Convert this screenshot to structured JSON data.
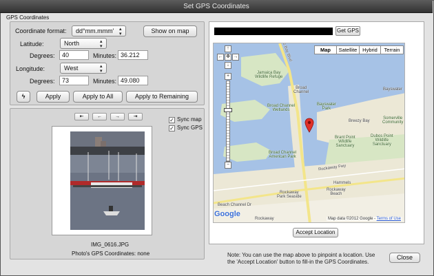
{
  "window": {
    "title": "Set GPS Coordinates"
  },
  "coords": {
    "section_label": "GPS Coordinates",
    "format_label": "Coordinate format:",
    "format_value": "dd°mm.mmm'",
    "show_on_map": "Show on map",
    "latitude_label": "Latitude:",
    "latitude_value": "North",
    "lat_degrees_label": "Degrees:",
    "lat_degrees": "40",
    "lat_minutes_label": "Minutes:",
    "lat_minutes": "36.212",
    "longitude_label": "Longitude:",
    "longitude_value": "West",
    "lon_degrees_label": "Degrees:",
    "lon_degrees": "73",
    "lon_minutes_label": "Minutes:",
    "lon_minutes": "49.080",
    "apply": "Apply",
    "apply_all": "Apply to All",
    "apply_remaining": "Apply to Remaining"
  },
  "photo": {
    "nav": [
      "⇤",
      "←",
      "→",
      "⇥"
    ],
    "sync_map": "Sync map",
    "sync_gps": "Sync GPS",
    "filename": "IMG_0616.JPG",
    "gps_status": "Photo's GPS Coordinates: none"
  },
  "map": {
    "get_gps": "Get GPS",
    "tabs": [
      "Map",
      "Satellite",
      "Hybrid",
      "Terrain"
    ],
    "active_tab": "Map",
    "labels": {
      "jamaica_bay": "Jamaica Bay\nWildlife Refuge",
      "broad_channel": "Broad\nChannel",
      "broad_channel_wetlands": "Broad Channel\nWetlands",
      "broad_channel_american_park": "Broad Channel\nAmerican Park",
      "bayswater": "Bayswater",
      "bayswater_park": "Bayswater\nPark",
      "breezy_bay": "Breezy Bay",
      "somerville": "Somerville\nCommunity",
      "brant_point": "Brant Point\nWildlife\nSanctuary",
      "dubos_point": "Dubos Point\nWildlife\nSanctuary",
      "rockaway_fwy": "Rockaway Fwy",
      "hammels": "Hammels",
      "rockaway_beach": "Rockaway\nBeach",
      "rockaway_park_seaside": "Rockaway\nPark Seaside",
      "beach_channel": "Beach Channel Dr",
      "rockaway_bottom": "Rockaway",
      "cross_bay": "Cross Bay Blvd"
    },
    "logo": "Google",
    "attribution": "Map data ©2012 Google",
    "terms": "Terms of Use",
    "accept": "Accept Location",
    "note": "Note: You can use the map above to pinpoint a location.  Use the 'Accept Location' button to fill-in the GPS Coordinates."
  },
  "footer": {
    "close": "Close"
  }
}
